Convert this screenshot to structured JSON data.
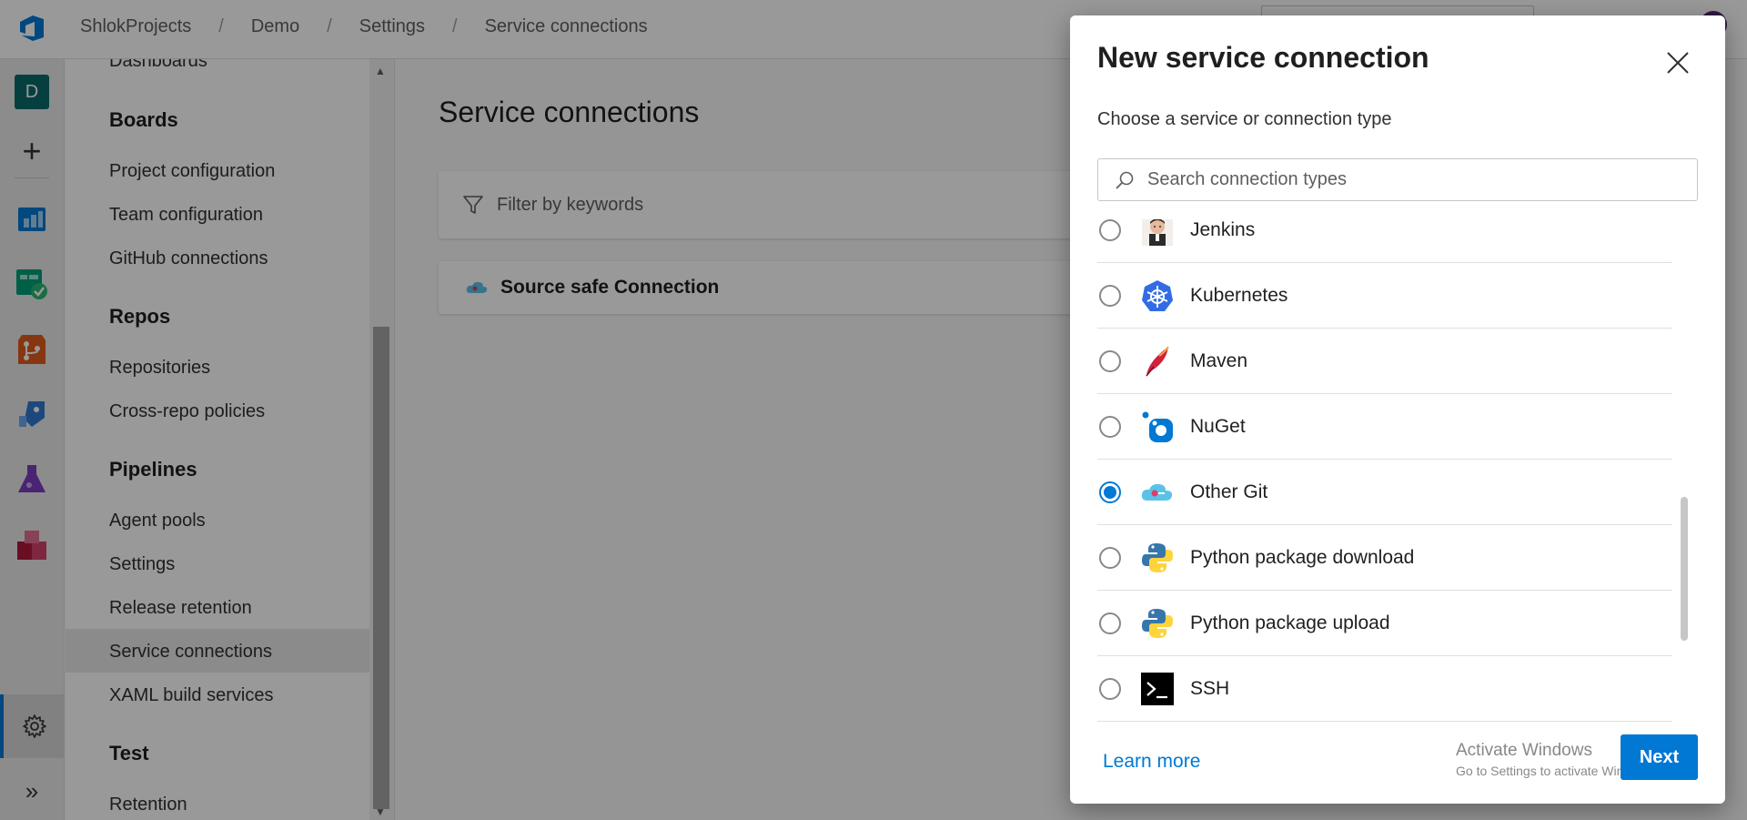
{
  "breadcrumb": {
    "org": "ShlokProjects",
    "project": "Demo",
    "settings": "Settings",
    "page": "Service connections",
    "separator": "/"
  },
  "rail": {
    "project_initial": "D",
    "add_symbol": "+",
    "expand_symbol": "»",
    "icons": [
      "azure-devops-logo-icon",
      "boards-icon",
      "test-plans-check-icon",
      "repos-icon",
      "pipelines-icon",
      "test-flask-icon",
      "artifacts-icon",
      "gear-icon"
    ]
  },
  "settings_nav": {
    "items": [
      {
        "type": "item",
        "label": "Dashboards"
      },
      {
        "type": "header",
        "label": "Boards"
      },
      {
        "type": "item",
        "label": "Project configuration"
      },
      {
        "type": "item",
        "label": "Team configuration"
      },
      {
        "type": "item",
        "label": "GitHub connections"
      },
      {
        "type": "header",
        "label": "Repos"
      },
      {
        "type": "item",
        "label": "Repositories"
      },
      {
        "type": "item",
        "label": "Cross-repo policies"
      },
      {
        "type": "header",
        "label": "Pipelines"
      },
      {
        "type": "item",
        "label": "Agent pools"
      },
      {
        "type": "item",
        "label": "Settings"
      },
      {
        "type": "item",
        "label": "Release retention"
      },
      {
        "type": "item",
        "label": "Service connections",
        "selected": true
      },
      {
        "type": "item",
        "label": "XAML build services"
      },
      {
        "type": "header",
        "label": "Test"
      },
      {
        "type": "item",
        "label": "Retention"
      }
    ]
  },
  "main": {
    "title": "Service connections",
    "filter_placeholder": "Filter by keywords",
    "connection_name": "Source safe Connection"
  },
  "dialog": {
    "title": "New service connection",
    "subtitle": "Choose a service or connection type",
    "search_placeholder": "Search connection types",
    "options": [
      {
        "label": "Jenkins",
        "icon": "jenkins-icon",
        "checked": false
      },
      {
        "label": "Kubernetes",
        "icon": "kubernetes-icon",
        "checked": false
      },
      {
        "label": "Maven",
        "icon": "maven-feather-icon",
        "checked": false
      },
      {
        "label": "NuGet",
        "icon": "nuget-icon",
        "checked": false
      },
      {
        "label": "Other Git",
        "icon": "other-git-cloud-icon",
        "checked": true
      },
      {
        "label": "Python package download",
        "icon": "python-icon",
        "checked": false
      },
      {
        "label": "Python package upload",
        "icon": "python-icon",
        "checked": false
      },
      {
        "label": "SSH",
        "icon": "ssh-terminal-icon",
        "checked": false
      }
    ],
    "learn_more": "Learn more",
    "next_label": "Next",
    "watermark_line1": "Activate Windows",
    "watermark_line2": "Go to Settings to activate Windows."
  },
  "colors": {
    "accent": "#0078d4",
    "project_badge": "#0b6a6a"
  }
}
